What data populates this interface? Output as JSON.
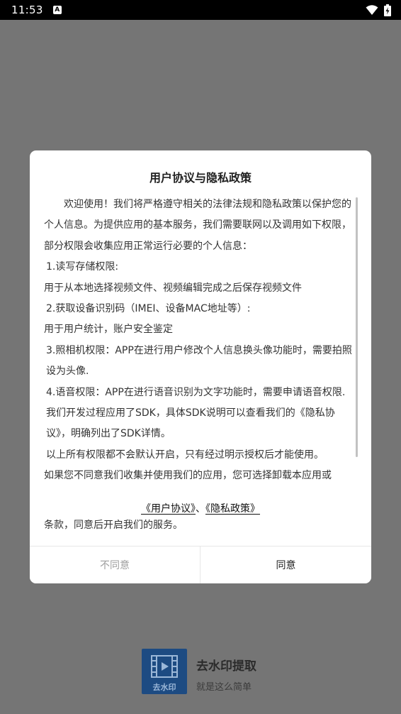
{
  "status_bar": {
    "time": "11:53",
    "notification_icon": "A"
  },
  "dialog": {
    "title": "用户协议与隐私政策",
    "body": [
      "　　欢迎使用！我们将严格遵守相关的法律法规和隐私政策以保护您的个人信息。为提供应用的基本服务，我们需要联网以及调用如下权限，部分权限会收集应用正常运行必要的个人信息：",
      "1.读写存储权限:",
      "用于从本地选择视频文件、视频编辑完成之后保存视频文件",
      "2.获取设备识别码（IMEI、设备MAC地址等）:",
      "用于用户统计，账户安全鉴定",
      "3.照相机权限：APP在进行用户修改个人信息换头像功能时，需要拍照设为头像.",
      "4.语音权限：APP在进行语音识别为文字功能时，需要申请语音权限.",
      "我们开发过程应用了SDK，具体SDK说明可以查看我们的《隐私协议》，明确列出了SDK详情。",
      "以上所有权限都不会默认开启，只有经过明示授权后才能使用。",
      "如果您不同意我们收集并使用我们的应用，您可选择卸载本应用或"
    ],
    "user_agreement_link": "《用户协议》",
    "separator": "、",
    "privacy_policy_link": "《隐私政策》",
    "tail": "条款，同意后开启我们的服务。",
    "disagree_label": "不同意",
    "agree_label": "同意"
  },
  "brand": {
    "logo_label": "去水印",
    "name": "去水印提取",
    "slogan": "就是这么简单"
  },
  "colors": {
    "overlay": "#757575",
    "logo_bg": "#1d4b82",
    "disagree_text": "#9e9e9e"
  }
}
